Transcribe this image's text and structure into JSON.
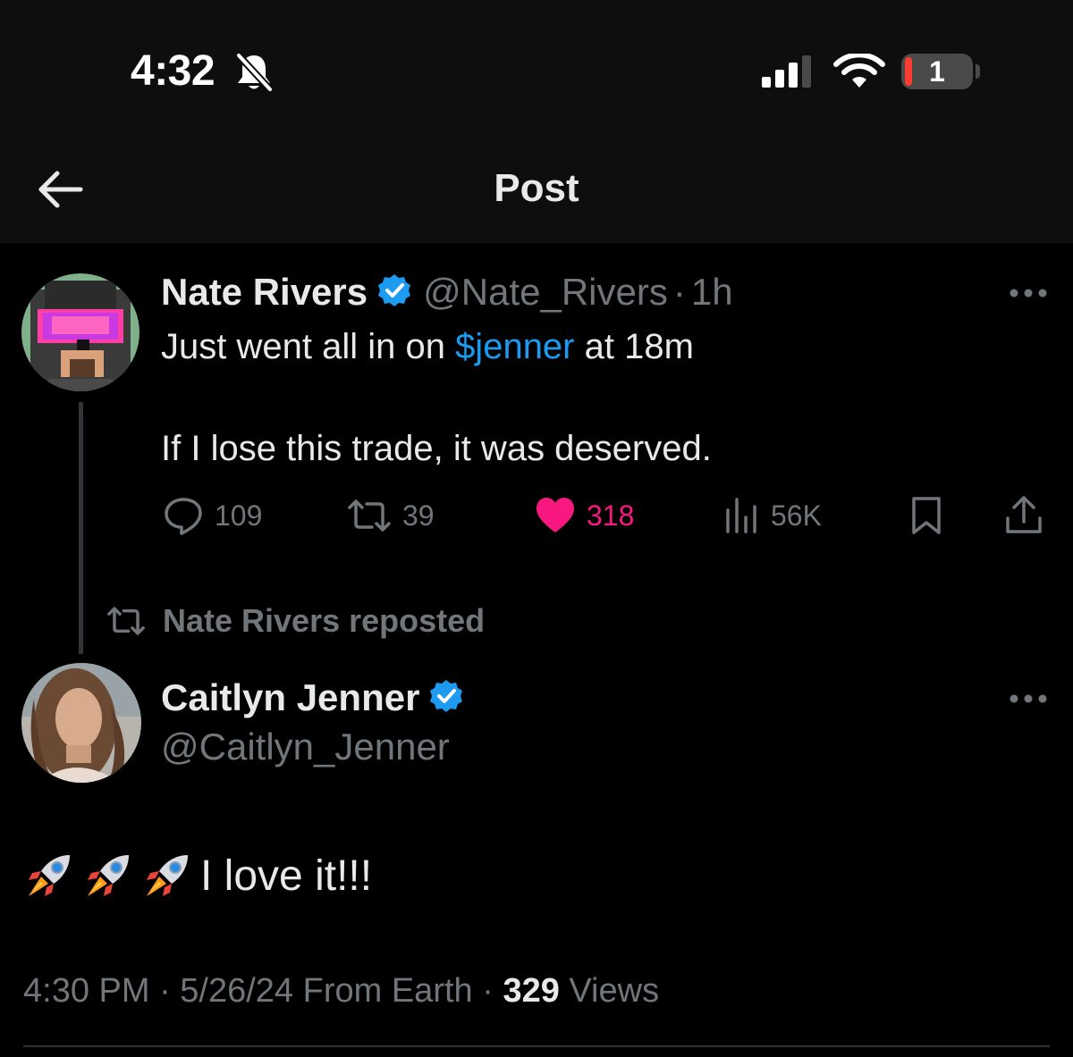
{
  "status_bar": {
    "time": "4:32",
    "battery_level": "1",
    "icons": [
      "bell-slash-icon",
      "cellular-signal-icon",
      "wifi-icon",
      "battery-icon"
    ]
  },
  "header": {
    "title": "Post",
    "back_icon": "arrow-left-icon"
  },
  "quoted_post": {
    "display_name": "Nate Rivers",
    "handle": "@Nate_Rivers",
    "separator": "·",
    "time_ago": "1h",
    "text_line_1_prefix": "Just went all in on ",
    "cashtag": "$jenner",
    "text_line_1_suffix": " at 18m",
    "text_line_2": "If I lose this trade, it was deserved.",
    "stats": {
      "replies": "109",
      "reposts": "39",
      "likes": "318",
      "views": "56K"
    },
    "liked": true,
    "colors": {
      "like": "#f91880",
      "link": "#1d9bf0",
      "verified": "#1d9bf0"
    }
  },
  "repost_banner": {
    "label": "Nate Rivers reposted",
    "icon": "repost-icon"
  },
  "main_post": {
    "display_name": "Caitlyn Jenner",
    "handle": "@Caitlyn_Jenner",
    "emoji": [
      "🚀",
      "🚀",
      "🚀"
    ],
    "text": "I love it!!!",
    "timestamp": "4:30 PM · 5/26/24 From Earth · ",
    "views_count": "329",
    "views_label": " Views"
  }
}
